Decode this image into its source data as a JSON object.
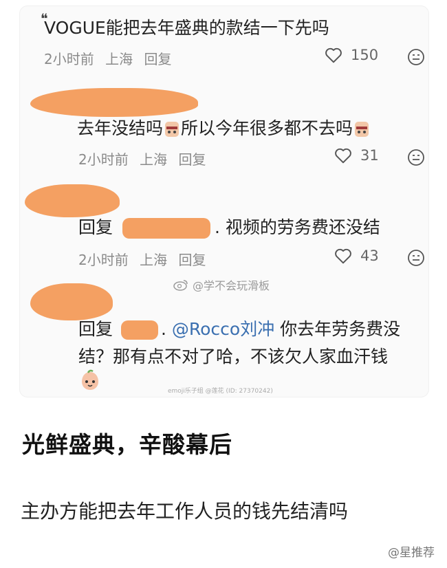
{
  "comments": [
    {
      "text": "VOGUE能把去年盛典的款结一下先吗",
      "time": "2小时前",
      "location": "上海",
      "reply_label": "回复",
      "likes": "150"
    },
    {
      "text_part1": "去年没结吗",
      "text_part2": "所以今年很多都不去吗",
      "time": "2小时前",
      "location": "上海",
      "reply_label": "回复",
      "likes": "31"
    },
    {
      "reply_prefix": "回复",
      "text": "视频的劳务费还没结",
      "time": "2小时前",
      "location": "上海",
      "reply_label": "回复",
      "likes": "43"
    },
    {
      "reply_prefix": "回复",
      "mention": "@Rocco刘冲",
      "text_line1": "你去年劳务费没",
      "text_line2": "结？那有点不对了哈，不该欠人家血汗钱"
    }
  ],
  "watermark": "@学不会玩滑板",
  "sticker_credit": "emoji乐子组 @莲花 (ID: 27370242)",
  "headline": "光鲜盛典，辛酸幕后",
  "body": "主办方能把去年工作人员的钱先结清吗",
  "footer_mark": "@星推荐",
  "colors": {
    "redaction": "#f4a062",
    "mention": "#3a6fb0"
  }
}
